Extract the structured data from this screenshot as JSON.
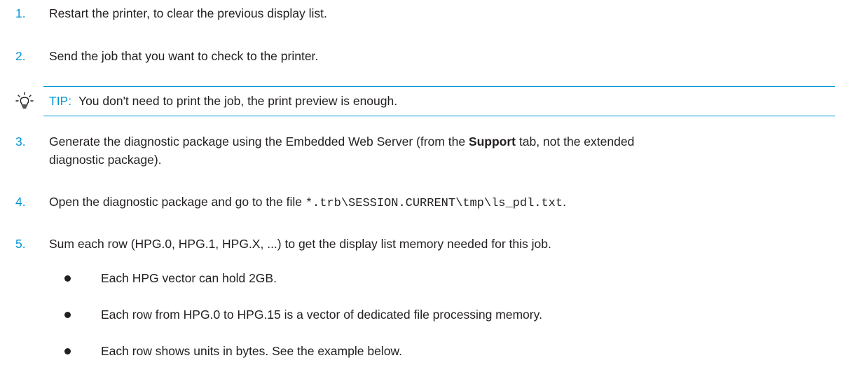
{
  "steps": [
    {
      "num": "1.",
      "text": "Restart the printer, to clear the previous display list."
    },
    {
      "num": "2.",
      "text": "Send the job that you want to check to the printer."
    },
    {
      "num": "3.",
      "text_before": "Generate the diagnostic package using the Embedded Web Server (from the ",
      "bold": "Support",
      "text_after": " tab, not the extended",
      "line2": "diagnostic package)."
    },
    {
      "num": "4.",
      "text_before": "Open the diagnostic package and go to the file ",
      "code": "*.trb\\SESSION.CURRENT\\tmp\\ls_pdl.txt",
      "text_after": "."
    },
    {
      "num": "5.",
      "text": "Sum each row (HPG.0, HPG.1, HPG.X, ...) to get the display list memory needed for this job."
    }
  ],
  "tip": {
    "icon": "lightbulb-icon",
    "label": "TIP:",
    "text": "You don't need to print the job, the print preview is enough."
  },
  "bullets": [
    "Each HPG vector can hold 2GB.",
    "Each row from HPG.0 to HPG.15 is a vector of dedicated file processing memory.",
    "Each row shows units in bytes. See the example below."
  ],
  "colors": {
    "accent": "#0096d6",
    "text": "#231f20"
  }
}
